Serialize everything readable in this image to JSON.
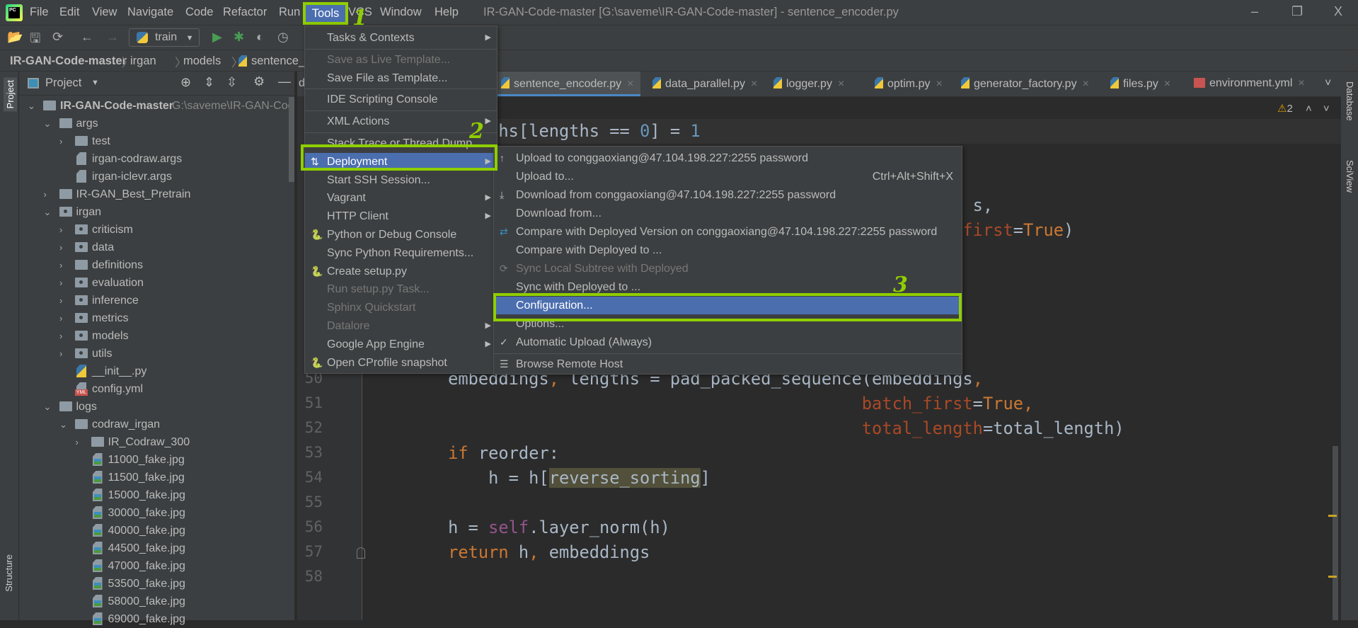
{
  "menubar": {
    "items": [
      "File",
      "Edit",
      "View",
      "Navigate",
      "Code",
      "Refactor",
      "Run",
      "Tools",
      "VCS",
      "Window",
      "Help"
    ],
    "active": "Tools"
  },
  "window_title": "IR-GAN-Code-master [G:\\saveme\\IR-GAN-Code-master] - sentence_encoder.py",
  "window_controls": {
    "minimize": "–",
    "restore": "❐",
    "close": "X"
  },
  "toolbar": {
    "run_config": "train"
  },
  "breadcrumb": [
    "IR-GAN-Code-master",
    "irgan",
    "models",
    "sentence_e"
  ],
  "left_stripe": {
    "project": "Project",
    "structure": "Structure"
  },
  "right_stripe": {
    "database": "Database",
    "sciview": "SciView"
  },
  "project_panel": {
    "title": "Project",
    "tree": [
      {
        "name": "IR-GAN-Code-master",
        "hint": "G:\\saveme\\IR-GAN-Cod",
        "level": 0,
        "type": "folder",
        "state": "open",
        "bold": true
      },
      {
        "name": "args",
        "level": 1,
        "type": "folder",
        "state": "open"
      },
      {
        "name": "test",
        "level": 2,
        "type": "folder",
        "state": "closed"
      },
      {
        "name": "irgan-codraw.args",
        "level": 2,
        "type": "file"
      },
      {
        "name": "irgan-iclevr.args",
        "level": 2,
        "type": "file"
      },
      {
        "name": "IR-GAN_Best_Pretrain",
        "level": 1,
        "type": "folder",
        "state": "closed"
      },
      {
        "name": "irgan",
        "level": 1,
        "type": "package",
        "state": "open"
      },
      {
        "name": "criticism",
        "level": 2,
        "type": "package",
        "state": "closed"
      },
      {
        "name": "data",
        "level": 2,
        "type": "package",
        "state": "closed"
      },
      {
        "name": "definitions",
        "level": 2,
        "type": "folder",
        "state": "closed"
      },
      {
        "name": "evaluation",
        "level": 2,
        "type": "package",
        "state": "closed"
      },
      {
        "name": "inference",
        "level": 2,
        "type": "package",
        "state": "closed"
      },
      {
        "name": "metrics",
        "level": 2,
        "type": "package",
        "state": "closed"
      },
      {
        "name": "models",
        "level": 2,
        "type": "package",
        "state": "closed"
      },
      {
        "name": "utils",
        "level": 2,
        "type": "package",
        "state": "closed"
      },
      {
        "name": "__init__.py",
        "level": 2,
        "type": "py"
      },
      {
        "name": "config.yml",
        "level": 2,
        "type": "yml"
      },
      {
        "name": "logs",
        "level": 1,
        "type": "folder",
        "state": "open"
      },
      {
        "name": "codraw_irgan",
        "level": 2,
        "type": "folder",
        "state": "open"
      },
      {
        "name": "IR_Codraw_300",
        "level": 3,
        "type": "folder",
        "state": "closed"
      },
      {
        "name": "11000_fake.jpg",
        "level": 3,
        "type": "jpg"
      },
      {
        "name": "11500_fake.jpg",
        "level": 3,
        "type": "jpg"
      },
      {
        "name": "15000_fake.jpg",
        "level": 3,
        "type": "jpg"
      },
      {
        "name": "30000_fake.jpg",
        "level": 3,
        "type": "jpg"
      },
      {
        "name": "40000_fake.jpg",
        "level": 3,
        "type": "jpg"
      },
      {
        "name": "44500_fake.jpg",
        "level": 3,
        "type": "jpg"
      },
      {
        "name": "47000_fake.jpg",
        "level": 3,
        "type": "jpg"
      },
      {
        "name": "53500_fake.jpg",
        "level": 3,
        "type": "jpg"
      },
      {
        "name": "58000_fake.jpg",
        "level": 3,
        "type": "jpg"
      },
      {
        "name": "69000_fake.jpg",
        "level": 3,
        "type": "jpg"
      }
    ]
  },
  "tabs": [
    {
      "label": "sentence_encoder.py",
      "active": true
    },
    {
      "label": "data_parallel.py"
    },
    {
      "label": "logger.py"
    },
    {
      "label": "optim.py"
    },
    {
      "label": "generator_factory.py"
    },
    {
      "label": "files.py"
    },
    {
      "label": "environment.yml",
      "yml": true
    }
  ],
  "tab_partial": "de",
  "editor": {
    "warnings": "2",
    "lines": [
      {
        "n": null,
        "row": 0,
        "segs": [
          [
            "            ths[lengths == ",
            ""
          ],
          [
            "0",
            "num"
          ],
          [
            "] = ",
            ""
          ],
          [
            "1",
            "num"
          ]
        ],
        "current": true
      },
      {
        "n": null,
        "row": 3,
        "segs": [
          [
            "                                                            s,",
            ""
          ]
        ]
      },
      {
        "n": null,
        "row": 4,
        "segs": [
          [
            "                                                           ",
            ""
          ],
          [
            "first",
            "prm"
          ],
          [
            "=",
            ""
          ],
          [
            "True",
            "kw"
          ],
          [
            ")",
            ""
          ]
        ]
      },
      {
        "n": "50",
        "row": 10,
        "segs": [
          [
            "        embeddings",
            ""
          ],
          [
            ",",
            "kw"
          ],
          [
            " lengths = pad_packed_sequence(embeddings",
            ""
          ],
          [
            ",",
            "kw"
          ]
        ]
      },
      {
        "n": "51",
        "row": 11,
        "segs": [
          [
            "                                                 ",
            ""
          ],
          [
            "batch_first",
            "prm"
          ],
          [
            "=",
            ""
          ],
          [
            "True",
            "kw"
          ],
          [
            ",",
            "kw"
          ]
        ]
      },
      {
        "n": "52",
        "row": 12,
        "segs": [
          [
            "                                                 ",
            ""
          ],
          [
            "total_length",
            "prm"
          ],
          [
            "=total_length)",
            ""
          ]
        ]
      },
      {
        "n": "53",
        "row": 13,
        "segs": [
          [
            "        ",
            ""
          ],
          [
            "if",
            "kw"
          ],
          [
            " reorder:",
            ""
          ]
        ]
      },
      {
        "n": "54",
        "row": 14,
        "segs": [
          [
            "            h = h[",
            ""
          ],
          [
            "reverse_sorting",
            "hl"
          ],
          [
            "]",
            ""
          ]
        ]
      },
      {
        "n": "55",
        "row": 15,
        "segs": []
      },
      {
        "n": "56",
        "row": 16,
        "segs": [
          [
            "        h = ",
            ""
          ],
          [
            "self",
            "self"
          ],
          [
            ".layer_norm(h)",
            ""
          ]
        ]
      },
      {
        "n": "57",
        "row": 17,
        "segs": [
          [
            "        ",
            ""
          ],
          [
            "return",
            "kw"
          ],
          [
            " h",
            ""
          ],
          [
            ",",
            "kw"
          ],
          [
            " embeddings",
            ""
          ]
        ]
      },
      {
        "n": "58",
        "row": 18,
        "segs": []
      }
    ]
  },
  "tools_menu": {
    "items": [
      {
        "label": "Tasks & Contexts",
        "submenu": true,
        "sep_after": true
      },
      {
        "label": "Save as Live Template...",
        "disabled": true
      },
      {
        "label": "Save File as Template...",
        "sep_after": true
      },
      {
        "label": "IDE Scripting Console",
        "sep_after": true
      },
      {
        "label": "XML Actions",
        "submenu": true,
        "sep_after": true
      },
      {
        "label": "Stack Trace or Thread Dump..."
      },
      {
        "label": "Deployment",
        "submenu": true,
        "selected": true,
        "icon": "deployment-icon",
        "glyph": "⇅"
      },
      {
        "label": "Start SSH Session..."
      },
      {
        "label": "Vagrant",
        "submenu": true
      },
      {
        "label": "HTTP Client",
        "submenu": true
      },
      {
        "label": "Python or Debug Console",
        "icon": "python-console-icon",
        "glyph": "🐍"
      },
      {
        "label": "Sync Python Requirements..."
      },
      {
        "label": "Create setup.py",
        "icon": "python-file-icon",
        "glyph": "🐍"
      },
      {
        "label": "Run setup.py Task...",
        "disabled": true
      },
      {
        "label": "Sphinx Quickstart",
        "disabled": true
      },
      {
        "label": "Datalore",
        "submenu": true,
        "disabled": true
      },
      {
        "label": "Google App Engine",
        "submenu": true
      },
      {
        "label": "Open CProfile snapshot",
        "icon": "cprofile-icon",
        "glyph": "🐍"
      }
    ]
  },
  "deployment_menu": {
    "items": [
      {
        "label": "Upload to conggaoxiang@47.104.198.227:2255 password",
        "icon": "upload-icon",
        "glyph": "↑"
      },
      {
        "label": "Upload to...",
        "shortcut": "Ctrl+Alt+Shift+X"
      },
      {
        "label": "Download from conggaoxiang@47.104.198.227:2255 password",
        "icon": "download-icon",
        "glyph": "⤓"
      },
      {
        "label": "Download from..."
      },
      {
        "label": "Compare with Deployed Version on conggaoxiang@47.104.198.227:2255 password",
        "icon": "compare-icon",
        "glyph": "⇄"
      },
      {
        "label": "Compare with Deployed to ..."
      },
      {
        "label": "Sync Local Subtree with Deployed",
        "disabled": true,
        "icon": "sync-icon",
        "glyph": "⟳"
      },
      {
        "label": "Sync with Deployed to ..."
      },
      {
        "label": "Configuration...",
        "selected": true
      },
      {
        "label": "Options..."
      },
      {
        "label": "Automatic Upload (Always)",
        "icon": "check-icon",
        "glyph": "✓",
        "sep_after": true
      },
      {
        "label": "Browse Remote Host",
        "icon": "server-icon",
        "glyph": "☰"
      }
    ]
  },
  "annotations": [
    "1",
    "2",
    "3"
  ],
  "colors": {
    "highlight": "#4b6eaf",
    "annotation": "#8fce00",
    "keyword": "#cc7832",
    "number": "#6897bb"
  }
}
